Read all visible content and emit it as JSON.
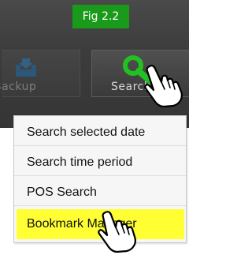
{
  "figure_label": "Fig 2.2",
  "toolbar": {
    "backup": {
      "label": "Backup",
      "icon": "backup-icon",
      "icon_color": "#1f6fb0"
    },
    "search": {
      "label": "Search",
      "icon": "search-icon",
      "icon_color": "#22c022"
    }
  },
  "menu": {
    "items": [
      {
        "label": "Search selected date",
        "highlighted": false
      },
      {
        "label": "Search time period",
        "highlighted": false
      },
      {
        "label": "POS Search",
        "highlighted": false
      },
      {
        "label": "Bookmark Manager",
        "highlighted": true
      }
    ]
  },
  "colors": {
    "figure_label_bg": "#1a9a1a",
    "toolbar_bg": "#3c3c3c",
    "menu_bg": "#f6f6f6",
    "highlight": "#ffff33"
  }
}
